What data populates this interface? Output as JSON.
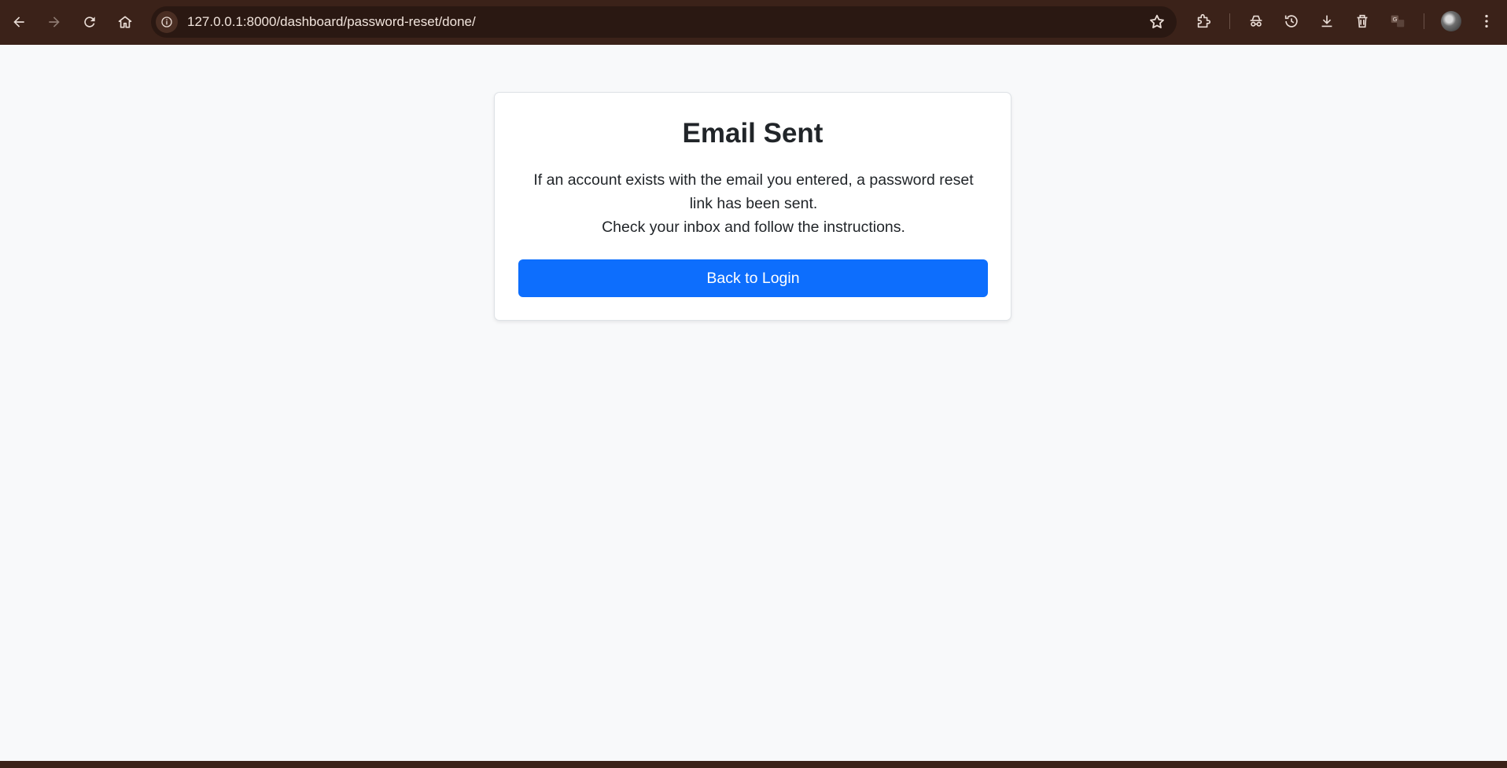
{
  "browser": {
    "url": "127.0.0.1:8000/dashboard/password-reset/done/",
    "icons": [
      "back-icon",
      "forward-icon",
      "reload-icon",
      "home-icon",
      "site-info-icon",
      "bookmark-star-icon",
      "extensions-icon",
      "incognito-icon",
      "history-icon",
      "download-icon",
      "trash-icon",
      "translate-icon",
      "profile-avatar",
      "more-menu-icon"
    ],
    "colors": {
      "toolbar": "#3b2219",
      "omnibox": "#2a1812"
    }
  },
  "card": {
    "title": "Email Sent",
    "message_line1": "If an account exists with the email you entered, a password reset link has been sent.",
    "message_line2": "Check your inbox and follow the instructions.",
    "button_label": "Back to Login"
  },
  "colors": {
    "primary": "#0d6efd",
    "page_background": "#f8f9fa",
    "text": "#212529"
  }
}
